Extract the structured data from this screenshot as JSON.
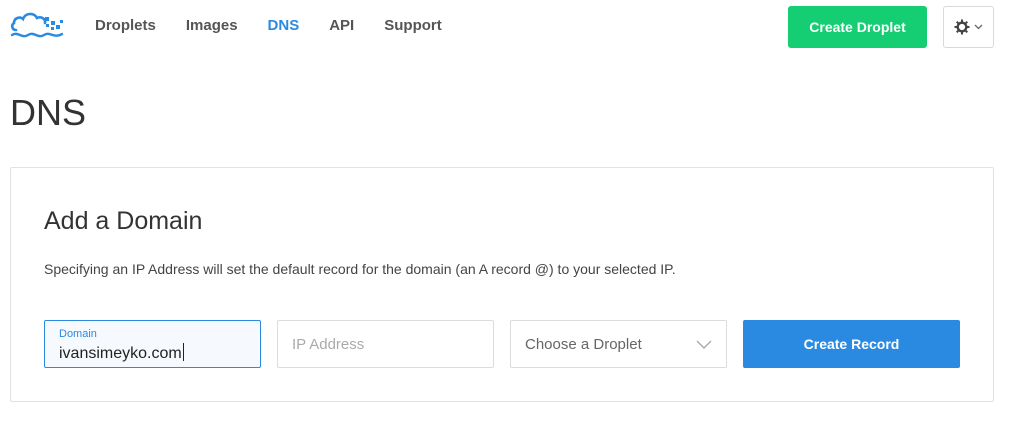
{
  "nav": {
    "logo_icon": "digitalocean-cloud-logo-icon",
    "items": [
      {
        "label": "Droplets",
        "active": false
      },
      {
        "label": "Images",
        "active": false
      },
      {
        "label": "DNS",
        "active": true
      },
      {
        "label": "API",
        "active": false
      },
      {
        "label": "Support",
        "active": false
      }
    ],
    "create_droplet_label": "Create Droplet",
    "settings_icon": "gear-icon",
    "settings_chevron_icon": "chevron-down-icon"
  },
  "page": {
    "title": "DNS"
  },
  "add_domain": {
    "title": "Add a Domain",
    "description": "Specifying an IP Address will set the default record for the domain (an A record @) to your selected IP.",
    "domain_field": {
      "label": "Domain",
      "value": "ivansimeyko.com"
    },
    "ip_field": {
      "placeholder": "IP Address",
      "value": ""
    },
    "droplet_select": {
      "selected": "Choose a Droplet"
    },
    "create_record_label": "Create Record"
  },
  "colors": {
    "accent_blue": "#2a8ae2",
    "create_green": "#15cd72"
  }
}
